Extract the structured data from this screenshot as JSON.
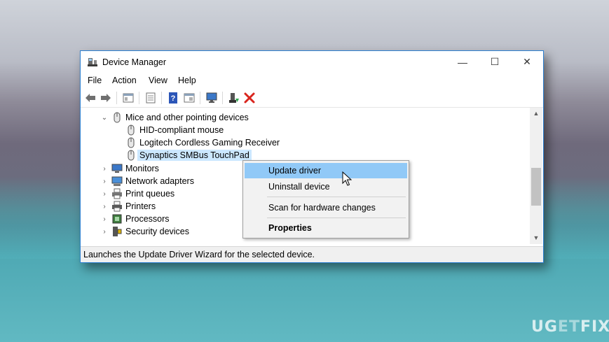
{
  "window": {
    "title": "Device Manager",
    "minimize_glyph": "—",
    "maximize_glyph": "☐",
    "close_glyph": "✕"
  },
  "menu": [
    "File",
    "Action",
    "View",
    "Help"
  ],
  "toolbar": {
    "icons": [
      "back-icon",
      "forward-icon",
      "show-hide-console-tree-icon",
      "properties-icon",
      "help-icon",
      "view-icon",
      "monitor-scan-icon",
      "update-driver-icon",
      "uninstall-icon"
    ],
    "colors": {
      "uninstall": "#d9251d",
      "help": "#2c56b8"
    }
  },
  "tree": {
    "category_expanded": {
      "label": "Mice and other pointing devices",
      "expander": "⌄"
    },
    "children": [
      "HID-compliant mouse",
      "Logitech Cordless Gaming Receiver",
      "Synaptics SMBus TouchPad"
    ],
    "selected": "Synaptics SMBus TouchPad",
    "categories_collapsed": [
      {
        "label": "Monitors",
        "icon": "monitor-icon"
      },
      {
        "label": "Network adapters",
        "icon": "network-adapter-icon"
      },
      {
        "label": "Print queues",
        "icon": "print-queue-icon"
      },
      {
        "label": "Printers",
        "icon": "printer-icon"
      },
      {
        "label": "Processors",
        "icon": "processor-icon"
      },
      {
        "label": "Security devices",
        "icon": "security-device-icon"
      }
    ],
    "collapsed_expander": "›"
  },
  "context_menu": {
    "items": [
      "Update driver",
      "Uninstall device",
      "Scan for hardware changes",
      "Properties"
    ],
    "highlighted": "Update driver",
    "bold": "Properties"
  },
  "statusbar": {
    "text": "Launches the Update Driver Wizard for the selected device."
  },
  "watermark": {
    "part1": "UG",
    "part2": "ET",
    "part3": "FIX"
  }
}
